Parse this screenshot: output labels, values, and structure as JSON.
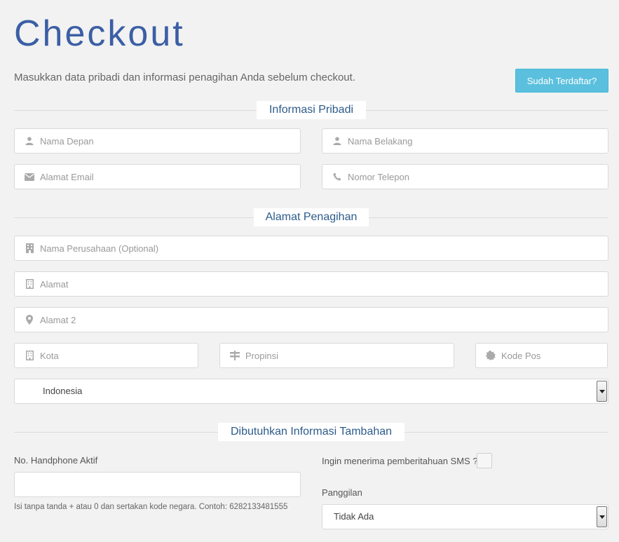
{
  "page": {
    "title": "Checkout",
    "intro": "Masukkan data pribadi dan informasi penagihan Anda sebelum checkout.",
    "login_button": "Sudah Terdaftar?"
  },
  "sections": {
    "personal": "Informasi Pribadi",
    "billing": "Alamat Penagihan",
    "additional": "Dibutuhkan Informasi Tambahan"
  },
  "personal_fields": {
    "first_name": {
      "placeholder": "Nama Depan",
      "icon": "user-icon"
    },
    "last_name": {
      "placeholder": "Nama Belakang",
      "icon": "user-icon"
    },
    "email": {
      "placeholder": "Alamat Email",
      "icon": "envelope-icon"
    },
    "phone": {
      "placeholder": "Nomor Telepon",
      "icon": "phone-icon"
    }
  },
  "billing_fields": {
    "company": {
      "placeholder": "Nama Perusahaan (Optional)",
      "icon": "building-icon"
    },
    "address1": {
      "placeholder": "Alamat",
      "icon": "building-outline-icon"
    },
    "address2": {
      "placeholder": "Alamat 2",
      "icon": "map-marker-icon"
    },
    "city": {
      "placeholder": "Kota",
      "icon": "building-outline-icon"
    },
    "state": {
      "placeholder": "Propinsi",
      "icon": "signpost-icon"
    },
    "postcode": {
      "placeholder": "Kode Pos",
      "icon": "badge-icon"
    },
    "country": {
      "selected": "Indonesia"
    }
  },
  "additional": {
    "mobile_label": "No. Handphone Aktif",
    "mobile_value": "",
    "mobile_help": "Isi tanpa tanda + atau 0 dan sertakan kode negara. Contoh: 6282133481555",
    "sms_label": "Ingin menerima pemberitahuan SMS ?",
    "sms_checked": false,
    "salutation_label": "Panggilan",
    "salutation_selected": "Tidak Ada"
  },
  "colors": {
    "title": "#3b5fa5",
    "section_heading": "#2d5b8a",
    "login_button_bg": "#5bc0de",
    "background": "#f2f2f2",
    "icon": "#aaaaaa"
  }
}
